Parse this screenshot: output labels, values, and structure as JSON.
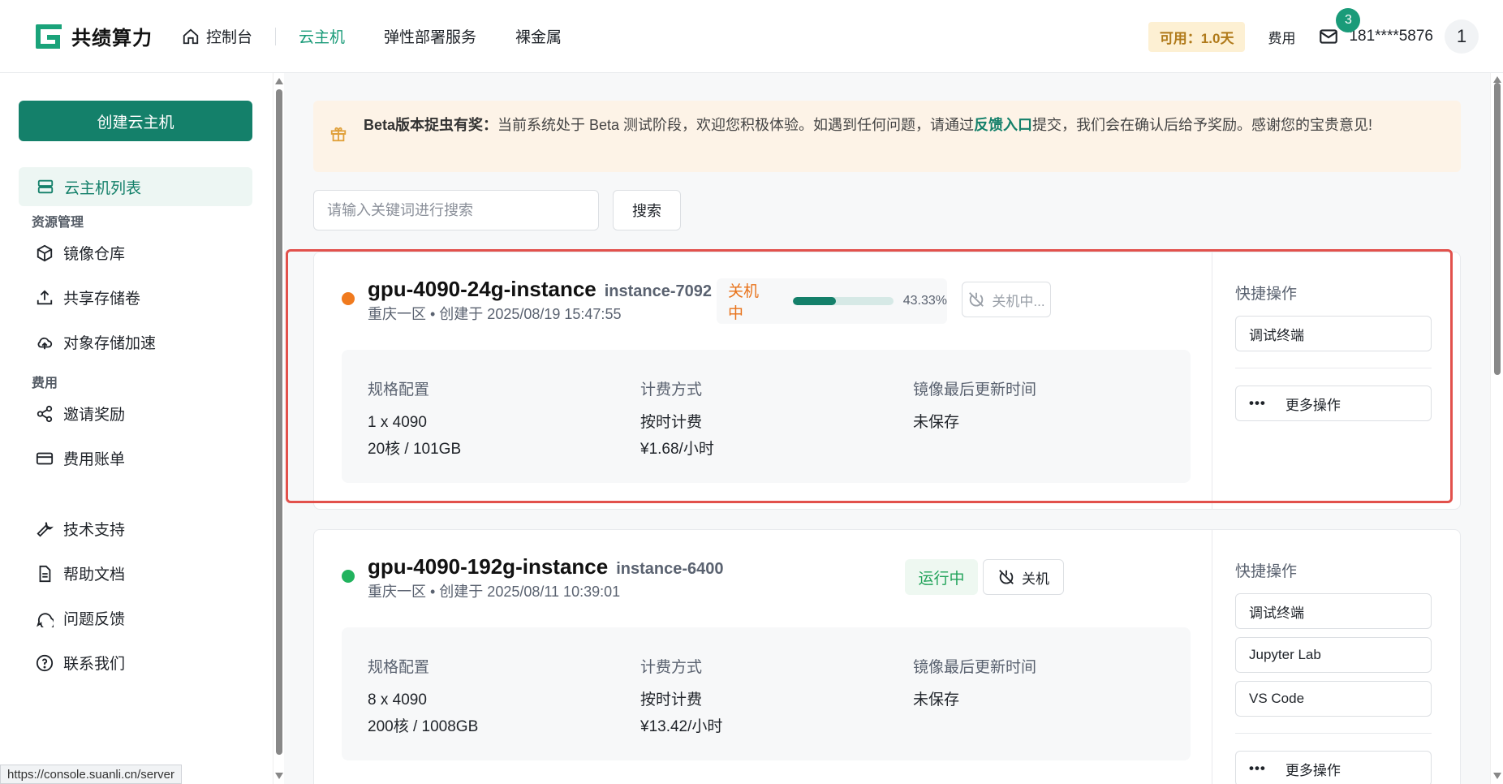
{
  "app": {
    "logo_text": "共绩算力",
    "nav": {
      "home": "控制台",
      "items": [
        "云主机",
        "弹性部署服务",
        "裸金属"
      ]
    },
    "available": "可用：1.0天",
    "fee": "费用",
    "mail_count": "3",
    "phone": "181****5876",
    "avatar": "1"
  },
  "sidebar": {
    "create_button": "创建云主机",
    "active_item": "云主机列表",
    "group_resources": "资源管理",
    "resources": [
      "镜像仓库",
      "共享存储卷",
      "对象存储加速"
    ],
    "group_fee": "费用",
    "fees": [
      "邀请奖励",
      "费用账单"
    ],
    "support": [
      "技术支持",
      "帮助文档",
      "问题反馈",
      "联系我们"
    ]
  },
  "beta": {
    "title": "Beta版本捉虫有奖：",
    "text1": "当前系统处于 Beta 测试阶段，欢迎您积极体验。如遇到任何问题，请通过",
    "link": "反馈入口",
    "text2": "提交，我们会在确认后给予奖励。感谢您的宝贵意见!"
  },
  "search": {
    "placeholder": "请输入关键词进行搜索",
    "button": "搜索"
  },
  "instances": [
    {
      "name": "gpu-4090-24g-instance",
      "id": "instance-7092",
      "meta": "重庆一区 • 创建于 2025/08/19 15:47:55",
      "status": "关机中",
      "status_color": "#e8731b",
      "dot_color": "#f07a1e",
      "progress": 0.4333,
      "progress_text": "43.33%",
      "power_button": "关机中...",
      "spec_label": "规格配置",
      "spec_line1": "1 x 4090",
      "spec_line2": "20核 / 101GB",
      "billing_label": "计费方式",
      "billing_type": "按时计费",
      "billing_price": "¥1.68/小时",
      "image_label": "镜像最后更新时间",
      "image_value": "未保存",
      "quick_title": "快捷操作",
      "quick_actions": [
        "调试终端"
      ],
      "more": "更多操作"
    },
    {
      "name": "gpu-4090-192g-instance",
      "id": "instance-6400",
      "meta": "重庆一区 • 创建于 2025/08/11 10:39:01",
      "status": "运行中",
      "status_color": "#22a35a",
      "dot_color": "#22b35e",
      "power_button": "关机",
      "spec_label": "规格配置",
      "spec_line1": "8 x 4090",
      "spec_line2": "200核 / 1008GB",
      "billing_label": "计费方式",
      "billing_type": "按时计费",
      "billing_price": "¥13.42/小时",
      "image_label": "镜像最后更新时间",
      "image_value": "未保存",
      "quick_title": "快捷操作",
      "quick_actions": [
        "调试终端",
        "Jupyter Lab",
        "VS Code"
      ],
      "more": "更多操作"
    }
  ],
  "statusbar": "https://console.suanli.cn/server"
}
